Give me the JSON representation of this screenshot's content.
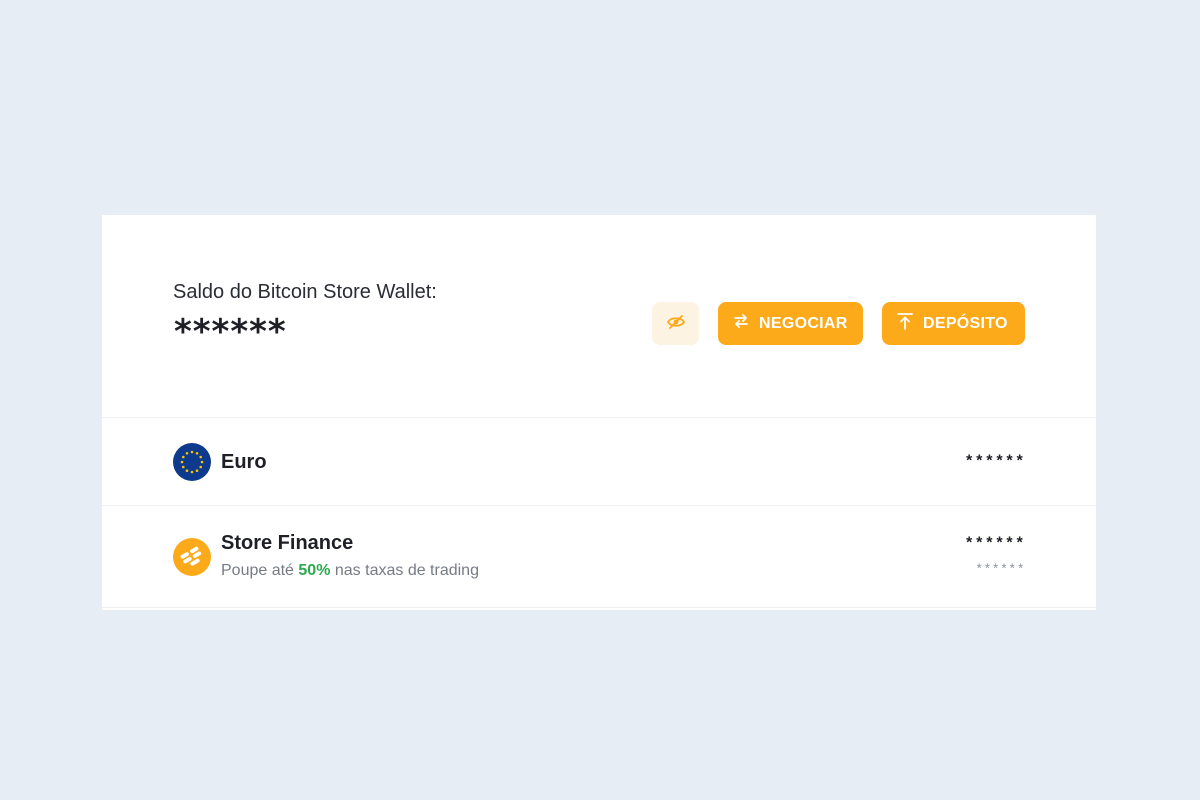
{
  "wallet": {
    "balance_label": "Saldo do Bitcoin Store Wallet:",
    "balance_value": "******"
  },
  "actions": {
    "hide_icon": "eye-off-icon",
    "trade_label": "NEGOCIAR",
    "trade_icon": "swap-arrows-icon",
    "deposit_label": "DEPÓSITO",
    "deposit_icon": "upload-arrow-icon"
  },
  "assets": [
    {
      "name": "Euro",
      "icon": "eu-flag-icon",
      "amount": "******"
    },
    {
      "name": "Store Finance",
      "icon": "store-finance-coin-icon",
      "subtitle_prefix": "Poupe até ",
      "subtitle_highlight": "50%",
      "subtitle_suffix": " nas taxas de trading",
      "amount": "******",
      "amount_secondary": "******"
    }
  ],
  "colors": {
    "accent": "#fcaa1a",
    "accent_soft": "#fdf3e3",
    "highlight_green": "#2da94f",
    "eu_blue": "#0d3a8c",
    "eu_star": "#f7c600",
    "background": "#e6edf4"
  }
}
